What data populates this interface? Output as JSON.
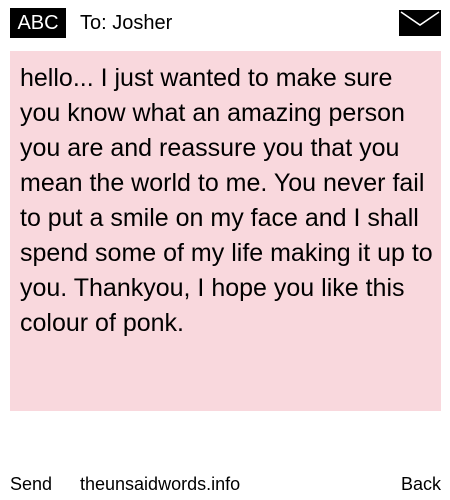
{
  "header": {
    "mode_badge": "ABC",
    "recipient_label": "To: Josher",
    "mail_icon": "envelope-icon"
  },
  "message": {
    "body": "hello... I just wanted to make sure you know what an amazing person you are and reassure you that you mean the world to me. You never fail to put a smile on my face and I shall spend some of my life making it up to you. Thankyou, I hope you like this colour of ponk.",
    "background_color": "#f9d8dd"
  },
  "footer": {
    "send_label": "Send",
    "site_label": "theunsaidwords.info",
    "back_label": "Back"
  }
}
